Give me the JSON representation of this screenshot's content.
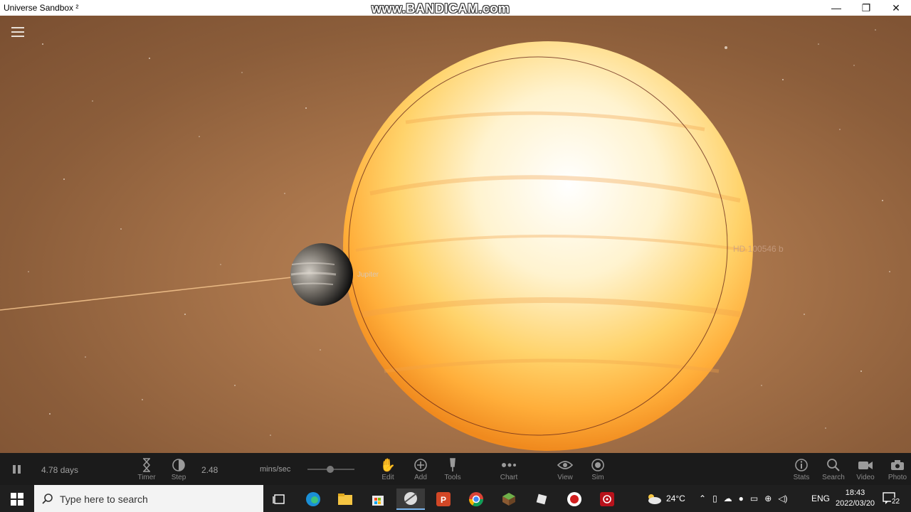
{
  "window": {
    "title": "Universe Sandbox ²",
    "watermark": "www.BANDICAM.com",
    "minimize": "—",
    "maximize": "❐",
    "close": "✕"
  },
  "scene": {
    "labels": {
      "jupiter": "Jupiter",
      "star": "HD 100546 b"
    }
  },
  "controls": {
    "elapsed": "4.78 days",
    "timer_label": "Timer",
    "step_label": "Step",
    "speed_value": "2.48",
    "speed_unit": "mins/sec",
    "edit_label": "Edit",
    "add_label": "Add",
    "tools_label": "Tools",
    "chart_label": "Chart",
    "view_label": "View",
    "sim_label": "Sim",
    "stats_label": "Stats",
    "search_label": "Search",
    "video_label": "Video",
    "photo_label": "Photo"
  },
  "taskbar": {
    "search_placeholder": "Type here to search",
    "weather": "24°C",
    "language": "ENG",
    "time": "18:43",
    "date": "2022/03/20",
    "notifications": "22"
  },
  "colors": {
    "accent_orange": "#ff9a1f",
    "background_brown": "#a9754b"
  }
}
